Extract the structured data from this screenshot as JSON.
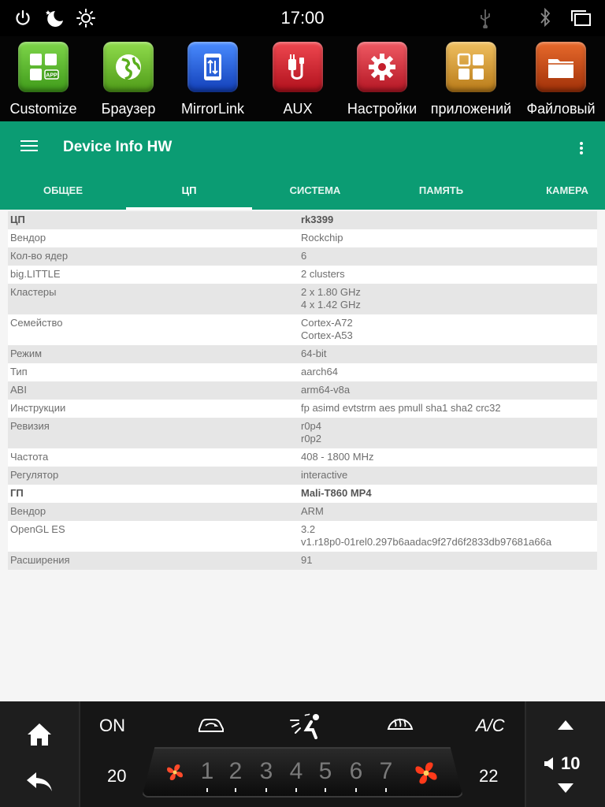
{
  "status_bar": {
    "time": "17:00",
    "icons": [
      "power-icon",
      "night-mode-icon",
      "brightness-icon",
      "usb-icon",
      "bluetooth-icon",
      "windows-icon"
    ]
  },
  "apps": [
    {
      "label": "Customize",
      "icon": "app-grid-icon",
      "color": "#5cb82c"
    },
    {
      "label": "Браузер",
      "icon": "globe-icon",
      "color": "#6cbf26"
    },
    {
      "label": "MirrorLink",
      "icon": "phone-transfer-icon",
      "color": "#1e5fe0"
    },
    {
      "label": "AUX",
      "icon": "aux-cable-icon",
      "color": "#d8202c"
    },
    {
      "label": "Настройки",
      "icon": "gear-icon",
      "color": "#d82030"
    },
    {
      "label": "приложений",
      "icon": "apps-grid-icon",
      "color": "#d79a2c"
    },
    {
      "label": "Файловый",
      "icon": "folder-icon",
      "color": "#c64a10"
    }
  ],
  "app_bar": {
    "title": "Device Info HW",
    "tabs": [
      "ОБЩЕЕ",
      "ЦП",
      "СИСТЕМА",
      "ПАМЯТЬ",
      "КАМЕРА"
    ],
    "active_tab": 1
  },
  "colors": {
    "accent": "#0b9c73",
    "row_alt": "#e6e6e6"
  },
  "rows": [
    {
      "key": "ЦП",
      "value": "rk3399",
      "header": true
    },
    {
      "key": "Вендор",
      "value": "Rockchip"
    },
    {
      "key": "Кол-во ядер",
      "value": "6"
    },
    {
      "key": "big.LITTLE",
      "value": "2 clusters"
    },
    {
      "key": "Кластеры",
      "value": "2 x 1.80 GHz\n4 x 1.42 GHz"
    },
    {
      "key": "Семейство",
      "value": "Cortex-A72\nCortex-A53"
    },
    {
      "key": "Режим",
      "value": "64-bit"
    },
    {
      "key": "Тип",
      "value": "aarch64"
    },
    {
      "key": "ABI",
      "value": "arm64-v8a"
    },
    {
      "key": "Инструкции",
      "value": "fp asimd evtstrm aes pmull sha1 sha2 crc32"
    },
    {
      "key": "Ревизия",
      "value": "r0p4\nr0p2"
    },
    {
      "key": "Частота",
      "value": "408 - 1800 MHz"
    },
    {
      "key": "Регулятор",
      "value": "interactive"
    },
    {
      "key": "ГП",
      "value": "Mali-T860 MP4",
      "header": true
    },
    {
      "key": "Вендор",
      "value": "ARM"
    },
    {
      "key": "OpenGL ES",
      "value": "3.2\nv1.r18p0-01rel0.297b6aadac9f27d6f2833db97681a66a"
    },
    {
      "key": "Расширения",
      "value": "91"
    }
  ],
  "climate": {
    "on_label": "ON",
    "ac_label": "A/C",
    "temp_left": "20",
    "temp_right": "22",
    "fan_speeds": [
      "1",
      "2",
      "3",
      "4",
      "5",
      "6",
      "7"
    ],
    "volume": "10"
  }
}
